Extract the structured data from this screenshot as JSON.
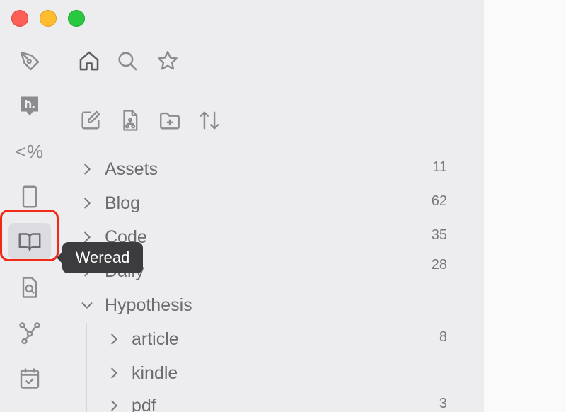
{
  "ribbon": {
    "html_icon_label": "<%"
  },
  "tooltip": {
    "text": "Weread"
  },
  "tree": {
    "folders": [
      {
        "label": "Assets",
        "count": "11"
      },
      {
        "label": "Blog",
        "count": "62"
      },
      {
        "label": "Code",
        "count": "35"
      },
      {
        "label": "Daily",
        "count": "28"
      },
      {
        "label": "Hypothesis",
        "count": ""
      }
    ],
    "subfolders": [
      {
        "label": "article",
        "count": "8"
      },
      {
        "label": "kindle",
        "count": ""
      },
      {
        "label": "pdf",
        "count": "3"
      }
    ]
  },
  "colors": {
    "highlight": "#f02a16",
    "icon_gray": "#8c8c90",
    "tooltip_bg": "#3c3c3e"
  }
}
